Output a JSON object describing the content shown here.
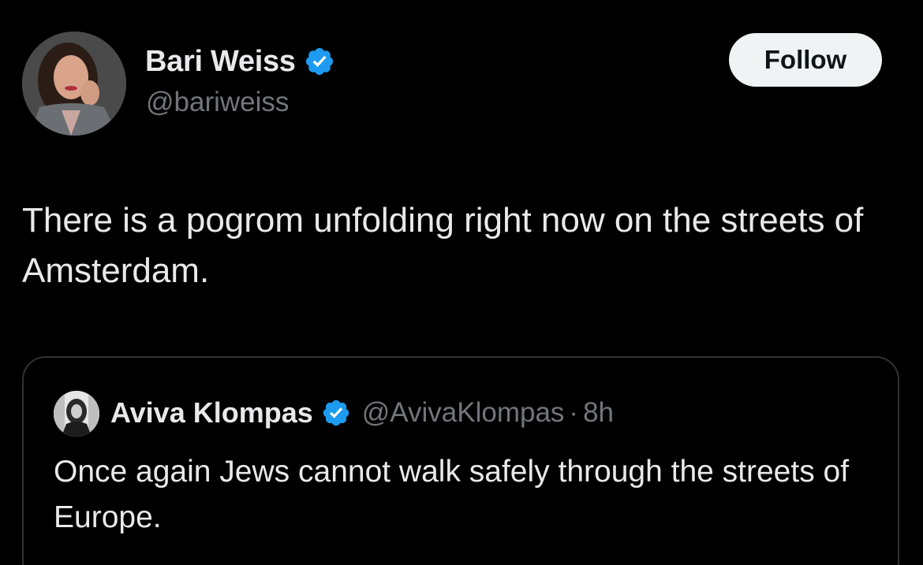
{
  "tweet": {
    "author": {
      "display_name": "Bari Weiss",
      "handle": "@bariweiss",
      "verified_icon": "verified-badge-icon"
    },
    "follow_label": "Follow",
    "text": "There is a pogrom unfolding right now on the streets of Amsterdam."
  },
  "quote": {
    "author": {
      "display_name": "Aviva Klompas",
      "handle": "@AvivaKlompas",
      "verified_icon": "verified-badge-icon"
    },
    "separator": "·",
    "time": "8h",
    "text": "Once again Jews cannot walk safely through the streets of Europe."
  },
  "colors": {
    "background": "#000000",
    "primary_text": "#e7e9ea",
    "secondary_text": "#71767b",
    "verified_blue": "#1d9bf0",
    "follow_button_bg": "#eff3f4",
    "card_border": "#2f3336"
  }
}
